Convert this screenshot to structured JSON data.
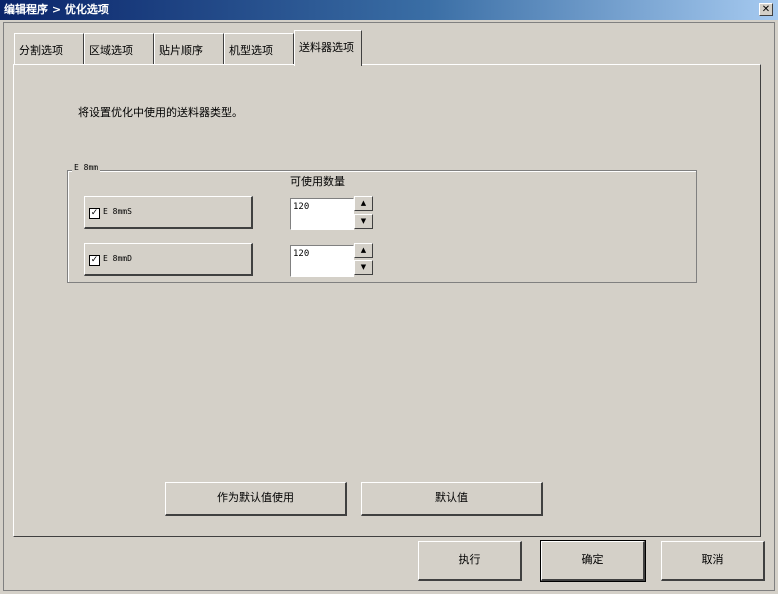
{
  "window": {
    "title": "编辑程序 > 优化选项",
    "close_label": "✕"
  },
  "tabs": [
    {
      "label": "分割选项"
    },
    {
      "label": "区域选项"
    },
    {
      "label": "贴片顺序"
    },
    {
      "label": "机型选项"
    },
    {
      "label": "送料器选项",
      "active": true
    }
  ],
  "panel": {
    "instruction": "将设置优化中使用的送料器类型。",
    "group": {
      "title": "E 8mm",
      "qty_header": "可使用数量",
      "feeders": [
        {
          "label": "E 8mmS",
          "checked": true,
          "qty": "120"
        },
        {
          "label": "E 8mmD",
          "checked": true,
          "qty": "120"
        }
      ]
    },
    "buttons": {
      "use_as_default": "作为默认值使用",
      "default": "默认值"
    }
  },
  "footer": {
    "execute": "执行",
    "ok": "确定",
    "cancel": "取消"
  },
  "icons": {
    "check": "check-icon",
    "spin_up": "up-arrow-icon",
    "spin_down": "down-arrow-icon"
  }
}
